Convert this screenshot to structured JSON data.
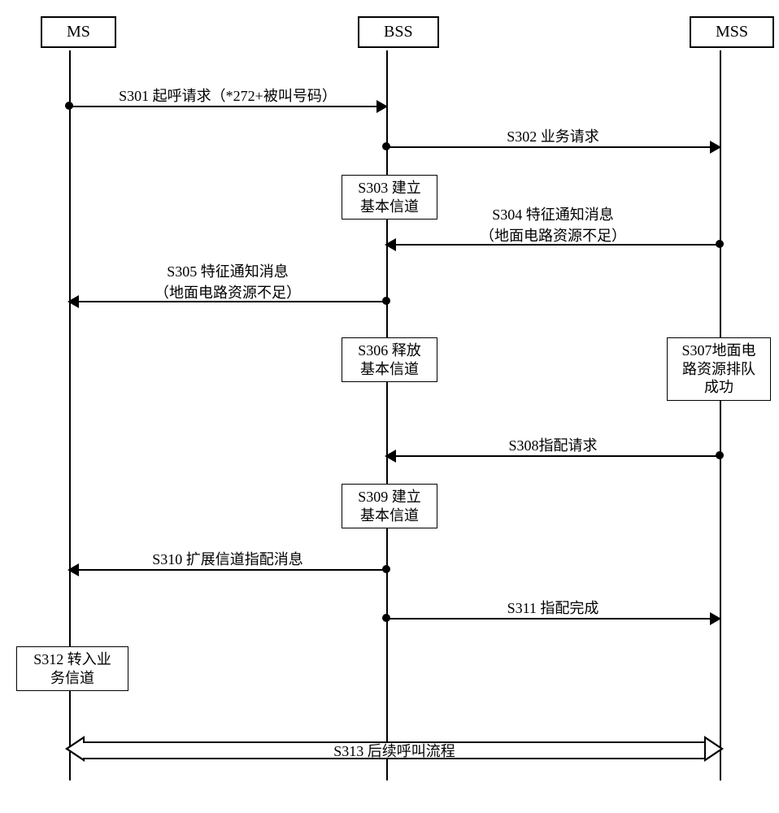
{
  "participants": {
    "ms": "MS",
    "bss": "BSS",
    "mss": "MSS"
  },
  "messages": {
    "s301": "S301 起呼请求（*272+被叫号码）",
    "s302": "S302 业务请求",
    "s303": "S303 建立\n基本信道",
    "s304_l1": "S304 特征通知消息",
    "s304_l2": "（地面电路资源不足）",
    "s305_l1": "S305 特征通知消息",
    "s305_l2": "（地面电路资源不足）",
    "s306": "S306 释放\n基本信道",
    "s307": "S307地面电\n路资源排队\n成功",
    "s308": "S308指配请求",
    "s309": "S309 建立\n基本信道",
    "s310": "S310 扩展信道指配消息",
    "s311": "S311 指配完成",
    "s312": "S312 转入业\n务信道",
    "s313": "S313 后续呼叫流程"
  }
}
